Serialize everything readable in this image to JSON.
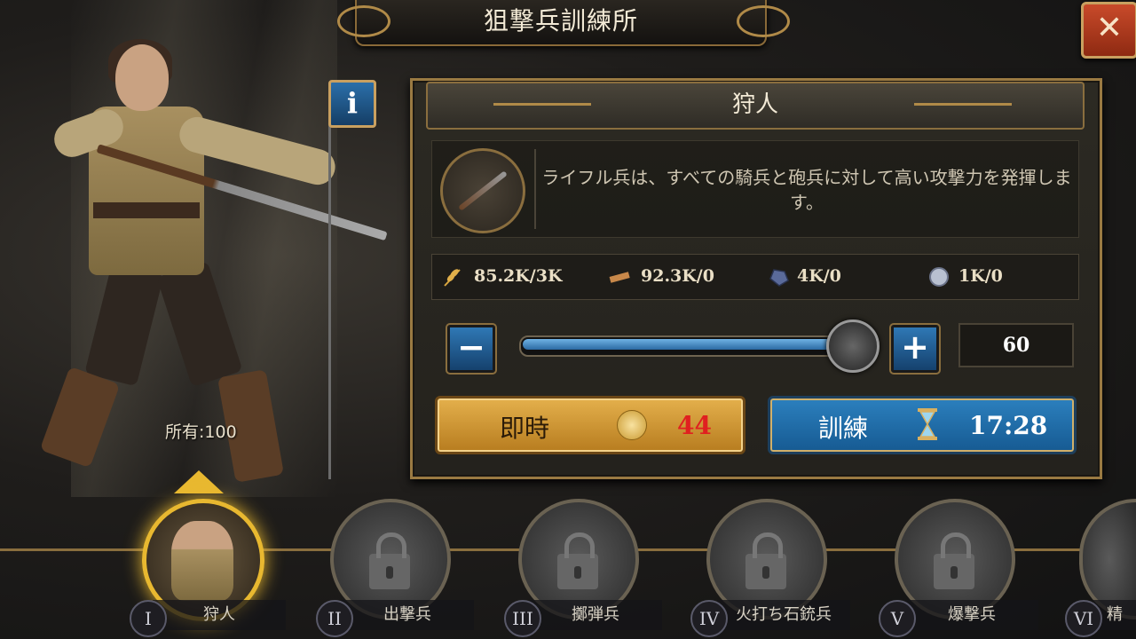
{
  "header": {
    "title": "狙撃兵訓練所"
  },
  "close_label": "✕",
  "info_label": "i",
  "hero": {
    "owned_label": "所有:100"
  },
  "panel": {
    "unit_title": "狩人",
    "description": "ライフル兵は、すべての騎兵と砲兵に対して高い攻撃力を発揮します。",
    "resources": [
      {
        "icon": "wheat-icon",
        "value": "85.2K/3K"
      },
      {
        "icon": "wood-icon",
        "value": "92.3K/0"
      },
      {
        "icon": "ore-icon",
        "value": "4K/0"
      },
      {
        "icon": "silver-icon",
        "value": "1K/0"
      }
    ],
    "slider": {
      "minus": "−",
      "plus": "+",
      "quantity": "60",
      "fill_fraction": 0.98
    },
    "instant": {
      "label": "即時",
      "cost": "44"
    },
    "train": {
      "label": "訓練",
      "time": "17:28"
    }
  },
  "units": [
    {
      "numeral": "I",
      "name": "狩人",
      "active": true
    },
    {
      "numeral": "II",
      "name": "出撃兵",
      "active": false
    },
    {
      "numeral": "III",
      "name": "擲弾兵",
      "active": false
    },
    {
      "numeral": "IV",
      "name": "火打ち石銃兵",
      "active": false
    },
    {
      "numeral": "V",
      "name": "爆撃兵",
      "active": false
    },
    {
      "numeral": "VI",
      "name": "精",
      "active": false
    }
  ],
  "colors": {
    "accent_gold": "#e8b830",
    "cost_red": "#e02020",
    "train_blue": "#2c80be"
  }
}
